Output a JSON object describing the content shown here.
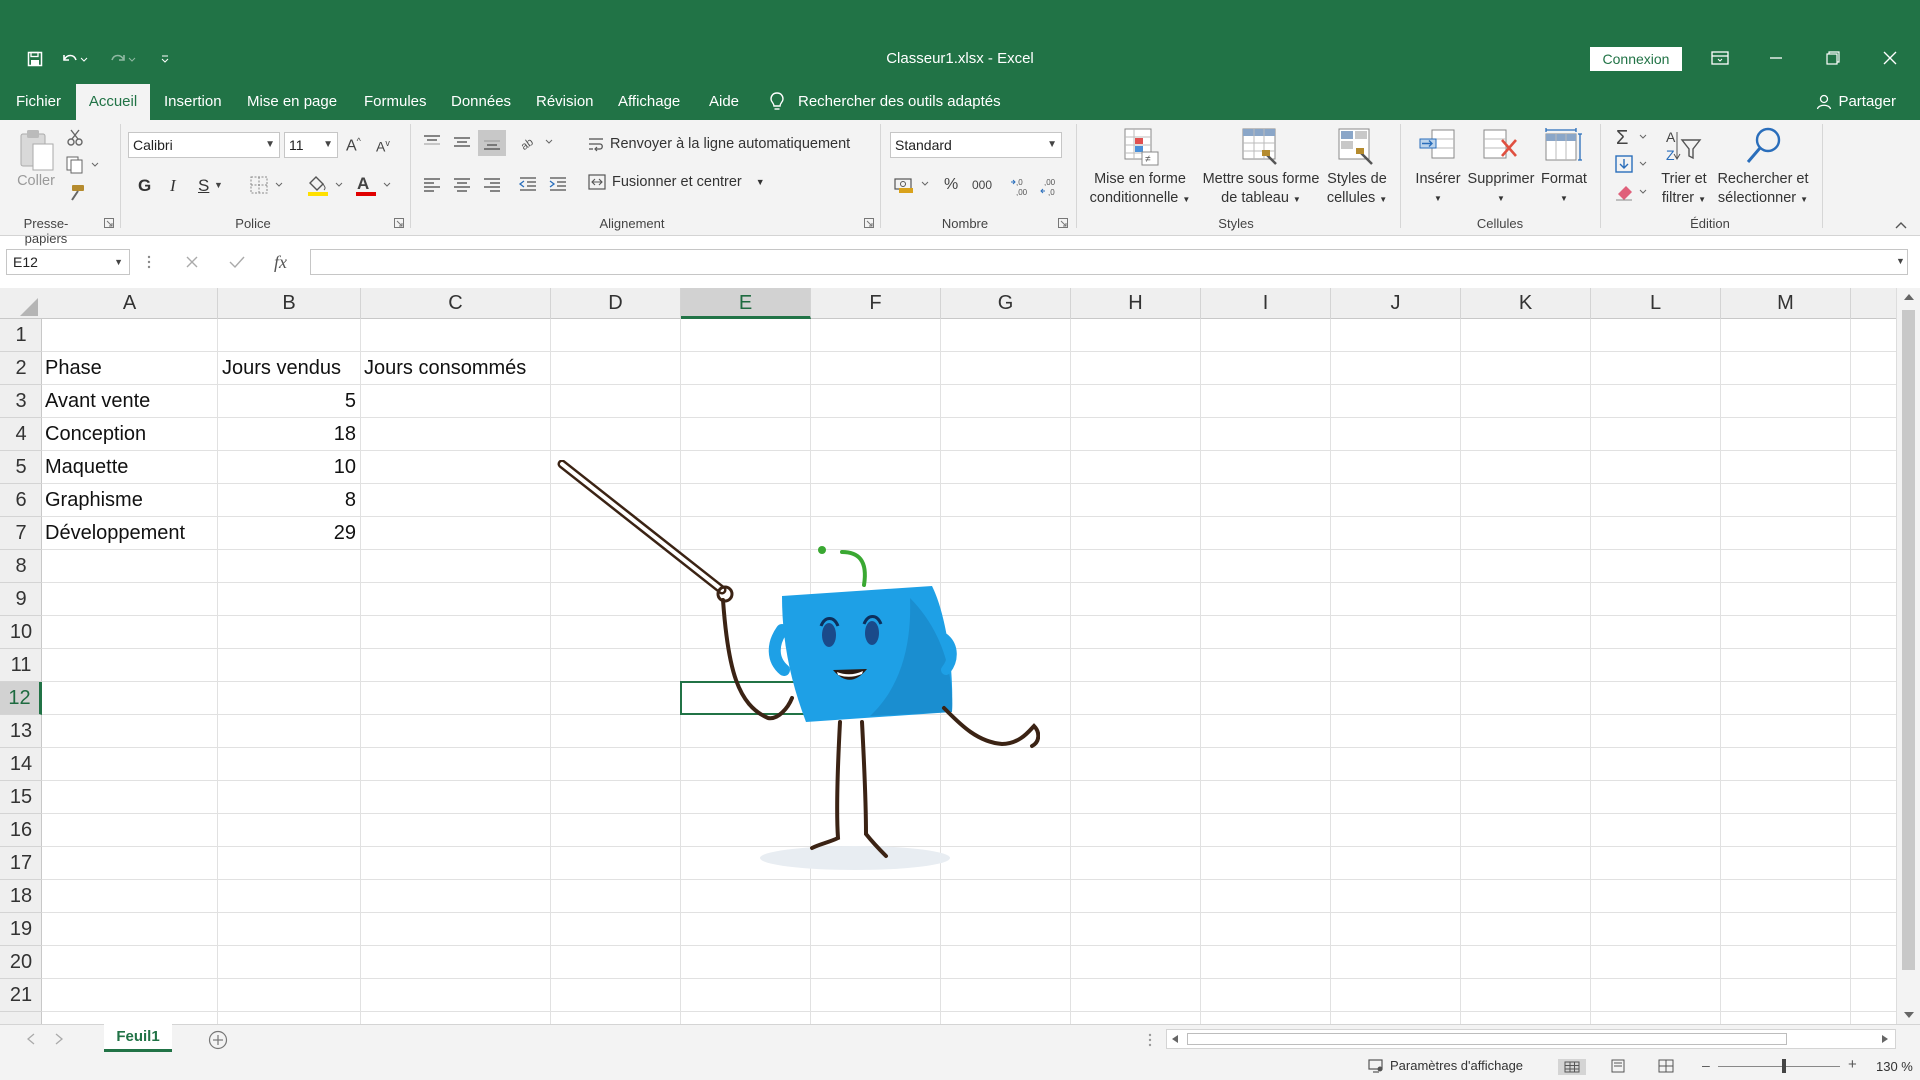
{
  "titlebar": {
    "doc_title": "Classeur1.xlsx  -  Excel",
    "connexion_label": "Connexion",
    "bg_color": "#217346"
  },
  "menu": {
    "tabs": [
      "Fichier",
      "Accueil",
      "Insertion",
      "Mise en page",
      "Formules",
      "Données",
      "Révision",
      "Affichage",
      "Aide"
    ],
    "active_tab": "Accueil",
    "search_label": "Rechercher des outils adaptés",
    "share_label": "Partager"
  },
  "ribbon": {
    "clipboard": {
      "paste_label": "Coller",
      "group_label": "Presse-papiers"
    },
    "font": {
      "font_name": "Calibri",
      "font_size": "11",
      "bold": "G",
      "italic": "I",
      "underline": "S",
      "group_label": "Police"
    },
    "alignment": {
      "wrap_label": "Renvoyer à la ligne automatiquement",
      "merge_label": "Fusionner et centrer",
      "group_label": "Alignement"
    },
    "number": {
      "format": "Standard",
      "group_label": "Nombre"
    },
    "styles": {
      "conditional_line1": "Mise en forme",
      "conditional_line2": "conditionnelle",
      "table_line1": "Mettre sous forme",
      "table_line2": "de tableau",
      "cellstyles_line1": "Styles de",
      "cellstyles_line2": "cellules",
      "group_label": "Styles"
    },
    "cells": {
      "insert_label": "Insérer",
      "delete_label": "Supprimer",
      "format_label": "Format",
      "group_label": "Cellules"
    },
    "editing": {
      "sort_line1": "Trier et",
      "sort_line2": "filtrer",
      "find_line1": "Rechercher et",
      "find_line2": "sélectionner",
      "group_label": "Édition"
    }
  },
  "formula_bar": {
    "name_box": "E12",
    "fx": "fx",
    "content": ""
  },
  "sheet": {
    "columns": [
      "A",
      "B",
      "C",
      "D",
      "E",
      "F",
      "G",
      "H",
      "I",
      "J",
      "K",
      "L",
      "M"
    ],
    "selected_column": "E",
    "rows": [
      "1",
      "2",
      "3",
      "4",
      "5",
      "6",
      "7",
      "8",
      "9",
      "10",
      "11",
      "12",
      "13",
      "14",
      "15",
      "16",
      "17",
      "18",
      "19",
      "20",
      "21"
    ],
    "selected_row": "12",
    "headers": {
      "phase": "Phase",
      "sold": "Jours vendus",
      "consumed": "Jours consommés"
    },
    "data": [
      {
        "phase": "Avant vente",
        "sold": "5"
      },
      {
        "phase": "Conception",
        "sold": "18"
      },
      {
        "phase": "Maquette",
        "sold": "10"
      },
      {
        "phase": "Graphisme",
        "sold": "8"
      },
      {
        "phase": "Développement",
        "sold": "29"
      }
    ]
  },
  "sheet_tabs": {
    "active": "Feuil1"
  },
  "status": {
    "display_settings": "Paramètres d'affichage",
    "zoom": "130 %"
  },
  "colors": {
    "accent": "#217346",
    "mascot_blue": "#1ea0e6",
    "mascot_line": "#3b2314"
  }
}
